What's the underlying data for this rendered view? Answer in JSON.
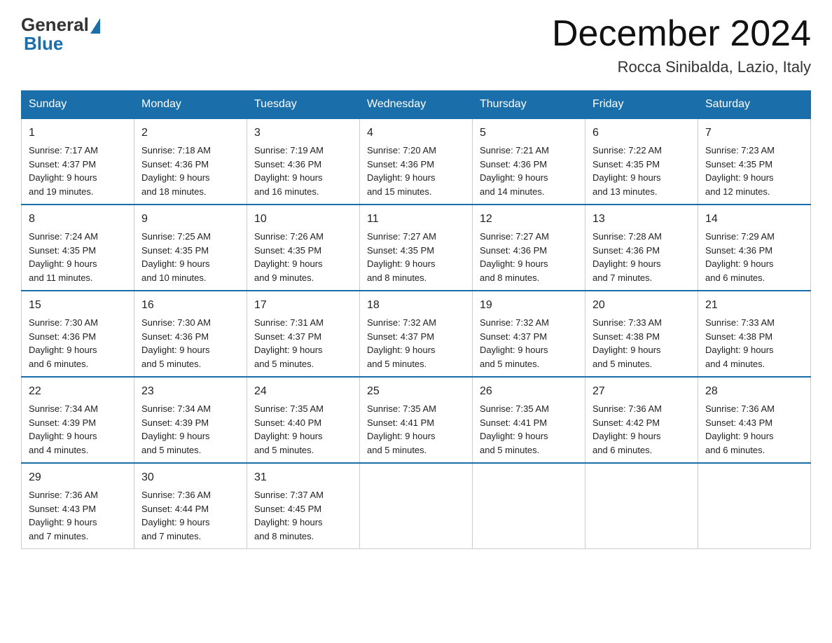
{
  "logo": {
    "general": "General",
    "blue": "Blue"
  },
  "title": "December 2024",
  "location": "Rocca Sinibalda, Lazio, Italy",
  "headers": [
    "Sunday",
    "Monday",
    "Tuesday",
    "Wednesday",
    "Thursday",
    "Friday",
    "Saturday"
  ],
  "weeks": [
    [
      {
        "day": "1",
        "sunrise": "7:17 AM",
        "sunset": "4:37 PM",
        "daylight": "9 hours and 19 minutes."
      },
      {
        "day": "2",
        "sunrise": "7:18 AM",
        "sunset": "4:36 PM",
        "daylight": "9 hours and 18 minutes."
      },
      {
        "day": "3",
        "sunrise": "7:19 AM",
        "sunset": "4:36 PM",
        "daylight": "9 hours and 16 minutes."
      },
      {
        "day": "4",
        "sunrise": "7:20 AM",
        "sunset": "4:36 PM",
        "daylight": "9 hours and 15 minutes."
      },
      {
        "day": "5",
        "sunrise": "7:21 AM",
        "sunset": "4:36 PM",
        "daylight": "9 hours and 14 minutes."
      },
      {
        "day": "6",
        "sunrise": "7:22 AM",
        "sunset": "4:35 PM",
        "daylight": "9 hours and 13 minutes."
      },
      {
        "day": "7",
        "sunrise": "7:23 AM",
        "sunset": "4:35 PM",
        "daylight": "9 hours and 12 minutes."
      }
    ],
    [
      {
        "day": "8",
        "sunrise": "7:24 AM",
        "sunset": "4:35 PM",
        "daylight": "9 hours and 11 minutes."
      },
      {
        "day": "9",
        "sunrise": "7:25 AM",
        "sunset": "4:35 PM",
        "daylight": "9 hours and 10 minutes."
      },
      {
        "day": "10",
        "sunrise": "7:26 AM",
        "sunset": "4:35 PM",
        "daylight": "9 hours and 9 minutes."
      },
      {
        "day": "11",
        "sunrise": "7:27 AM",
        "sunset": "4:35 PM",
        "daylight": "9 hours and 8 minutes."
      },
      {
        "day": "12",
        "sunrise": "7:27 AM",
        "sunset": "4:36 PM",
        "daylight": "9 hours and 8 minutes."
      },
      {
        "day": "13",
        "sunrise": "7:28 AM",
        "sunset": "4:36 PM",
        "daylight": "9 hours and 7 minutes."
      },
      {
        "day": "14",
        "sunrise": "7:29 AM",
        "sunset": "4:36 PM",
        "daylight": "9 hours and 6 minutes."
      }
    ],
    [
      {
        "day": "15",
        "sunrise": "7:30 AM",
        "sunset": "4:36 PM",
        "daylight": "9 hours and 6 minutes."
      },
      {
        "day": "16",
        "sunrise": "7:30 AM",
        "sunset": "4:36 PM",
        "daylight": "9 hours and 5 minutes."
      },
      {
        "day": "17",
        "sunrise": "7:31 AM",
        "sunset": "4:37 PM",
        "daylight": "9 hours and 5 minutes."
      },
      {
        "day": "18",
        "sunrise": "7:32 AM",
        "sunset": "4:37 PM",
        "daylight": "9 hours and 5 minutes."
      },
      {
        "day": "19",
        "sunrise": "7:32 AM",
        "sunset": "4:37 PM",
        "daylight": "9 hours and 5 minutes."
      },
      {
        "day": "20",
        "sunrise": "7:33 AM",
        "sunset": "4:38 PM",
        "daylight": "9 hours and 5 minutes."
      },
      {
        "day": "21",
        "sunrise": "7:33 AM",
        "sunset": "4:38 PM",
        "daylight": "9 hours and 4 minutes."
      }
    ],
    [
      {
        "day": "22",
        "sunrise": "7:34 AM",
        "sunset": "4:39 PM",
        "daylight": "9 hours and 4 minutes."
      },
      {
        "day": "23",
        "sunrise": "7:34 AM",
        "sunset": "4:39 PM",
        "daylight": "9 hours and 5 minutes."
      },
      {
        "day": "24",
        "sunrise": "7:35 AM",
        "sunset": "4:40 PM",
        "daylight": "9 hours and 5 minutes."
      },
      {
        "day": "25",
        "sunrise": "7:35 AM",
        "sunset": "4:41 PM",
        "daylight": "9 hours and 5 minutes."
      },
      {
        "day": "26",
        "sunrise": "7:35 AM",
        "sunset": "4:41 PM",
        "daylight": "9 hours and 5 minutes."
      },
      {
        "day": "27",
        "sunrise": "7:36 AM",
        "sunset": "4:42 PM",
        "daylight": "9 hours and 6 minutes."
      },
      {
        "day": "28",
        "sunrise": "7:36 AM",
        "sunset": "4:43 PM",
        "daylight": "9 hours and 6 minutes."
      }
    ],
    [
      {
        "day": "29",
        "sunrise": "7:36 AM",
        "sunset": "4:43 PM",
        "daylight": "9 hours and 7 minutes."
      },
      {
        "day": "30",
        "sunrise": "7:36 AM",
        "sunset": "4:44 PM",
        "daylight": "9 hours and 7 minutes."
      },
      {
        "day": "31",
        "sunrise": "7:37 AM",
        "sunset": "4:45 PM",
        "daylight": "9 hours and 8 minutes."
      },
      null,
      null,
      null,
      null
    ]
  ],
  "labels": {
    "sunrise": "Sunrise:",
    "sunset": "Sunset:",
    "daylight": "Daylight:"
  }
}
